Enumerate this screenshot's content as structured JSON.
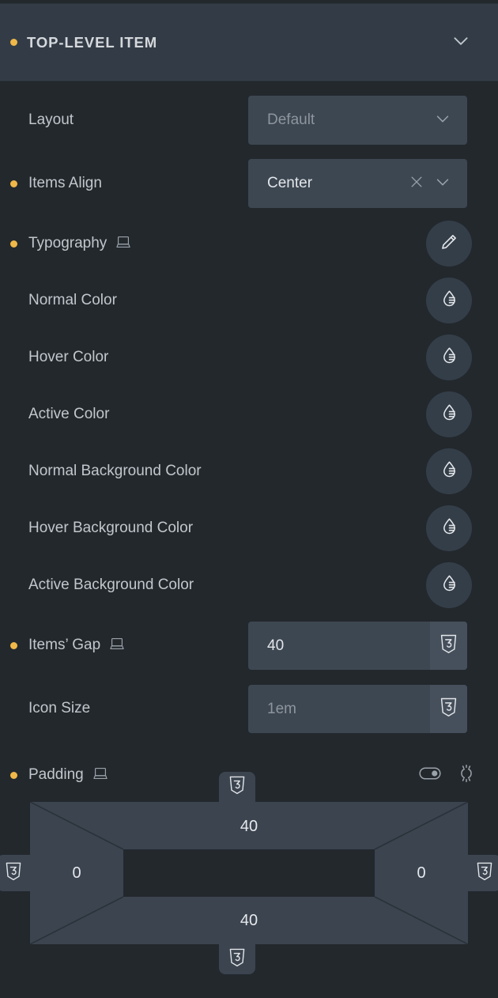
{
  "panel": {
    "section": {
      "title": "TOP-LEVEL ITEM",
      "has_change_indicator": true,
      "collapse_icon": "chevron-down-icon"
    },
    "accent_color": "#f0b849",
    "background_color": "#23282d",
    "header_background_color": "#333c46",
    "field_background_color": "#3d4752",
    "controls": [
      {
        "key": "layout",
        "label": "Layout",
        "type": "select",
        "value": "Default",
        "is_placeholder": true,
        "changed": false,
        "icons": [
          "chevron-down-icon"
        ]
      },
      {
        "key": "items_align",
        "label": "Items Align",
        "type": "select",
        "value": "Center",
        "is_placeholder": false,
        "changed": true,
        "icons": [
          "close-icon",
          "chevron-down-icon"
        ]
      },
      {
        "key": "typography",
        "label": "Typography",
        "type": "popover",
        "changed": true,
        "device_icon": "laptop-icon",
        "button_icon": "pencil-icon"
      },
      {
        "key": "normal_color",
        "label": "Normal Color",
        "type": "color",
        "changed": false,
        "button_icon": "droplet-icon"
      },
      {
        "key": "hover_color",
        "label": "Hover Color",
        "type": "color",
        "changed": false,
        "button_icon": "droplet-icon"
      },
      {
        "key": "active_color",
        "label": "Active Color",
        "type": "color",
        "changed": false,
        "button_icon": "droplet-icon"
      },
      {
        "key": "normal_bg_color",
        "label": "Normal Background Color",
        "type": "color",
        "changed": false,
        "button_icon": "droplet-icon"
      },
      {
        "key": "hover_bg_color",
        "label": "Hover Background Color",
        "type": "color",
        "changed": false,
        "button_icon": "droplet-icon"
      },
      {
        "key": "active_bg_color",
        "label": "Active Background Color",
        "type": "color",
        "changed": false,
        "button_icon": "droplet-icon"
      },
      {
        "key": "items_gap",
        "label": "Items’ Gap",
        "type": "number",
        "value": "40",
        "is_placeholder": false,
        "changed": true,
        "device_icon": "laptop-icon",
        "unit_icon": "css3-shield-icon"
      },
      {
        "key": "icon_size",
        "label": "Icon Size",
        "type": "number",
        "value": "1em",
        "is_placeholder": true,
        "changed": false,
        "unit_icon": "css3-shield-icon"
      }
    ],
    "padding": {
      "label": "Padding",
      "changed": true,
      "device_icon": "laptop-icon",
      "link_toggle_icon": "link-values-toggle-icon",
      "reset_icon": "unlink-values-icon",
      "top": "40",
      "right": "0",
      "bottom": "40",
      "left": "0",
      "unit_icon": "css3-shield-icon"
    }
  }
}
